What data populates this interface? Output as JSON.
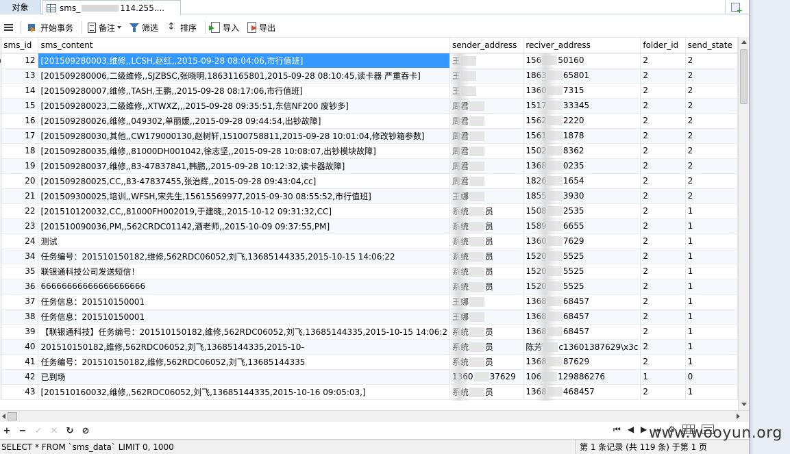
{
  "tabs": {
    "objects_label": "对象",
    "active_title_prefix": "sms_",
    "active_title_suffix": "114.255...."
  },
  "toolbar": {
    "begin_transaction": "开始事务",
    "memo": "备注",
    "filter": "筛选",
    "sort": "排序",
    "import": "导入",
    "export": "导出"
  },
  "columns": [
    "sms_id",
    "sms_content",
    "sender_address",
    "reciver_address",
    "folder_id",
    "send_state"
  ],
  "rows": [
    {
      "id": "12",
      "content": "[201509280003,维修,,LCSH,赵红,,2015-09-28 08:04:06,市行值班]",
      "sender": "王",
      "receiver_pre": "156",
      "receiver_post": "50160",
      "folder": "2",
      "state": "2"
    },
    {
      "id": "13",
      "content": "[201509280006,二级维修,,SJZBSC,张晓明,18631165801,2015-09-28 08:10:45,读卡器  严重吞卡]",
      "sender": "王",
      "receiver_pre": "1863",
      "receiver_post": "65801",
      "folder": "2",
      "state": "2"
    },
    {
      "id": "14",
      "content": "[201509280007,维修,,TASH,王鹏,,2015-09-28 08:17:06,市行值班]",
      "sender": "王",
      "receiver_pre": "1360",
      "receiver_post": "7315",
      "folder": "2",
      "state": "2"
    },
    {
      "id": "15",
      "content": "[201509280023,二级维修,,XTWXZ,,,2015-09-28 09:35:51,东信NF200 废钞多]",
      "sender": "周君",
      "receiver_pre": "1517",
      "receiver_post": "33345",
      "folder": "2",
      "state": "2"
    },
    {
      "id": "16",
      "content": "[201509280026,维修,,049302,单丽媛,,2015-09-28 09:44:54,出钞故障]",
      "sender": "周君",
      "receiver_pre": "1562",
      "receiver_post": "2220",
      "folder": "2",
      "state": "2"
    },
    {
      "id": "17",
      "content": "[201509280030,其他,,CW179000130,赵树轩,15100758811,2015-09-28 10:01:04,修改钞箱参数]",
      "sender": "周君",
      "receiver_pre": "1561",
      "receiver_post": "1878",
      "folder": "2",
      "state": "2"
    },
    {
      "id": "18",
      "content": "[201509280035,维修,,81000DH001042,徐志坚,,2015-09-28 10:08:07,出钞模块故障]",
      "sender": "周君",
      "receiver_pre": "1502",
      "receiver_post": "8362",
      "folder": "2",
      "state": "2"
    },
    {
      "id": "19",
      "content": "[201509280037,维修,,83-47837841,韩鹏,,2015-09-28 10:12:32,读卡器故障]",
      "sender": "周君",
      "receiver_pre": "1368",
      "receiver_post": "0235",
      "folder": "2",
      "state": "2"
    },
    {
      "id": "20",
      "content": "[201509280025,CC,,83-47837455,张治辉,,2015-09-28 09:43:04,cc]",
      "sender": "周君",
      "receiver_pre": "1826",
      "receiver_post": "1654",
      "folder": "2",
      "state": "2"
    },
    {
      "id": "21",
      "content": "[201509300025,培训,,WFSH,宋先生,15615569977,2015-09-30 08:55:52,市行值班]",
      "sender": "王娜",
      "receiver_pre": "1855",
      "receiver_post": "3930",
      "folder": "2",
      "state": "2"
    },
    {
      "id": "22",
      "content": "[201510120032,CC,,81000FH002019,于建晓,,2015-10-12 09:31:32,CC]",
      "sender": "系统",
      "sender_post": "员",
      "receiver_pre": "1508",
      "receiver_post": "2535",
      "folder": "2",
      "state": "1"
    },
    {
      "id": "23",
      "content": "[201510090036,PM,,562CRDC01142,酒老师,,2015-10-09 09:37:55,PM]",
      "sender": "系统",
      "sender_post": "员",
      "receiver_pre": "1589",
      "receiver_post": "6655",
      "folder": "2",
      "state": "1"
    },
    {
      "id": "24",
      "content": "测试",
      "sender": "系统",
      "sender_post": "员",
      "receiver_pre": "1360",
      "receiver_post": "7629",
      "folder": "2",
      "state": "1"
    },
    {
      "id": "34",
      "content": "任务编号：201510150182,维修,562RDC06052,刘飞,13685144335,2015-10-15 14:06:22",
      "sender": "系统",
      "sender_post": "员",
      "receiver_pre": "1520",
      "receiver_post": "5525",
      "folder": "2",
      "state": "1"
    },
    {
      "id": "35",
      "content": "联银通科技公司发送短信！",
      "sender": "系统",
      "sender_post": "员",
      "receiver_pre": "1520",
      "receiver_post": "5525",
      "folder": "2",
      "state": "1"
    },
    {
      "id": "36",
      "content": "66666666666666666666",
      "sender": "系统",
      "sender_post": "员",
      "receiver_pre": "1520",
      "receiver_post": "5525",
      "folder": "2",
      "state": "1"
    },
    {
      "id": "37",
      "content": "任务信息：201510150001",
      "sender": "王娜",
      "receiver_pre": "1368",
      "receiver_post": "68457",
      "folder": "2",
      "state": "1"
    },
    {
      "id": "38",
      "content": "任务信息：201510150001",
      "sender": "王娜",
      "receiver_pre": "1368",
      "receiver_post": "68457",
      "folder": "2",
      "state": "1"
    },
    {
      "id": "39",
      "content": "【联银通科技】任务编号：201510150182,维修,562RDC06052,刘飞,13685144335,2015-10-15 14:06:2",
      "sender": "系统",
      "sender_post": "员",
      "receiver_pre": "1368",
      "receiver_post": "68457",
      "folder": "2",
      "state": "1"
    },
    {
      "id": "40",
      "content": "201510150182,维修,562RDC06052,刘飞,13685144335,2015-10-",
      "sender": "系统",
      "sender_post": "员",
      "receiver_pre": "陈芳",
      "receiver_post": "c13601387629\\x3c",
      "folder": "2",
      "state": "1"
    },
    {
      "id": "41",
      "content": "任务编号：201510150182,维修,562RDC06052,刘飞,13685144335",
      "sender": "系统",
      "sender_post": "员",
      "receiver_pre": "1368",
      "receiver_post": "87629",
      "folder": "2",
      "state": "1"
    },
    {
      "id": "42",
      "content": "已到场",
      "sender": "1360",
      "sender_post": "37629",
      "receiver_pre": "106",
      "receiver_post": "129886276",
      "folder": "1",
      "state": "0"
    },
    {
      "id": "43",
      "content": "[201510160032,维修,,562RDC06052,刘飞,13685144335,2015-10-16 09:05:03,]",
      "sender": "系统",
      "sender_post": "员",
      "receiver_pre": "1368",
      "receiver_post": "468457",
      "folder": "2",
      "state": "1"
    }
  ],
  "nav": {
    "add": "+",
    "delete": "−",
    "apply": "✓",
    "cancel": "✕",
    "refresh": "↻",
    "stop": "⊘",
    "first": "⏮",
    "prev": "◀",
    "next": "▶",
    "last": "⏭",
    "settings": "⚙"
  },
  "status": {
    "sql": "SELECT * FROM `sms_data` LIMIT 0, 1000",
    "records": "第 1 条记录 (共 119 条) 于第 1 页"
  },
  "watermark": "www.wooyun.org",
  "selected_row_index": 0,
  "colors": {
    "selection": "#3399ff",
    "alt_row": "#f5f8fc",
    "tab_bg": "#dae6f3"
  }
}
